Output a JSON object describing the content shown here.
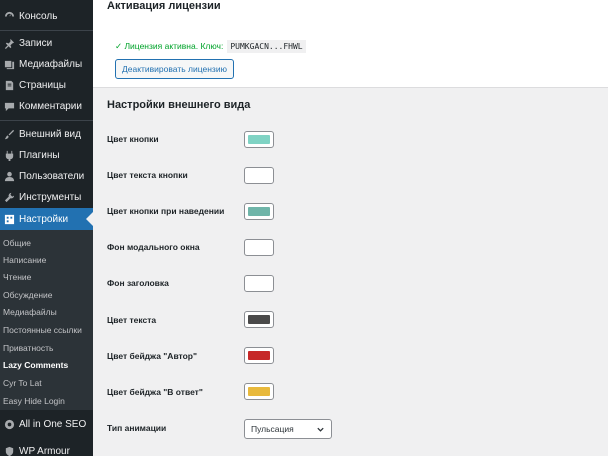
{
  "sidebar": {
    "items": [
      {
        "label": "Консоль",
        "icon": "dashboard-icon"
      },
      {
        "label": "Записи",
        "icon": "pin-icon"
      },
      {
        "label": "Медиафайлы",
        "icon": "media-icon"
      },
      {
        "label": "Страницы",
        "icon": "page-icon"
      },
      {
        "label": "Комментарии",
        "icon": "comment-icon"
      },
      {
        "label": "Внешний вид",
        "icon": "brush-icon"
      },
      {
        "label": "Плагины",
        "icon": "plugin-icon"
      },
      {
        "label": "Пользователи",
        "icon": "user-icon"
      },
      {
        "label": "Инструменты",
        "icon": "wrench-icon"
      },
      {
        "label": "Настройки",
        "icon": "settings-icon"
      }
    ],
    "submenu": [
      "Общие",
      "Написание",
      "Чтение",
      "Обсуждение",
      "Медиафайлы",
      "Постоянные ссылки",
      "Приватность",
      "Lazy Comments",
      "Cyr To Lat",
      "Easy Hide Login"
    ],
    "bottom_items": [
      {
        "label": "All in One SEO",
        "icon": "seo-icon"
      },
      {
        "label": "WP Armour",
        "icon": "shield-icon"
      }
    ]
  },
  "license": {
    "title": "Активация лицензии",
    "status_text": "✓ Лицензия активна. Ключ:",
    "key": "PUMKGACN...FHWL",
    "deactivate_label": "Деактивировать лицензию"
  },
  "appearance": {
    "title": "Настройки внешнего вида",
    "colors": [
      {
        "label": "Цвет кнопки",
        "color": "#7fd3c4"
      },
      {
        "label": "Цвет текста кнопки",
        "color": "#ffffff"
      },
      {
        "label": "Цвет кнопки при наведении",
        "color": "#6fb5a9"
      },
      {
        "label": "Фон модального окна",
        "color": "#ffffff"
      },
      {
        "label": "Фон заголовка",
        "color": "#ffffff"
      },
      {
        "label": "Цвет текста",
        "color": "#4a4a4a"
      },
      {
        "label": "Цвет бейджа \"Автор\"",
        "color": "#c62828"
      },
      {
        "label": "Цвет бейджа \"В ответ\"",
        "color": "#e8b93c"
      }
    ],
    "animation_label": "Тип анимации",
    "animation_value": "Пульсация"
  }
}
